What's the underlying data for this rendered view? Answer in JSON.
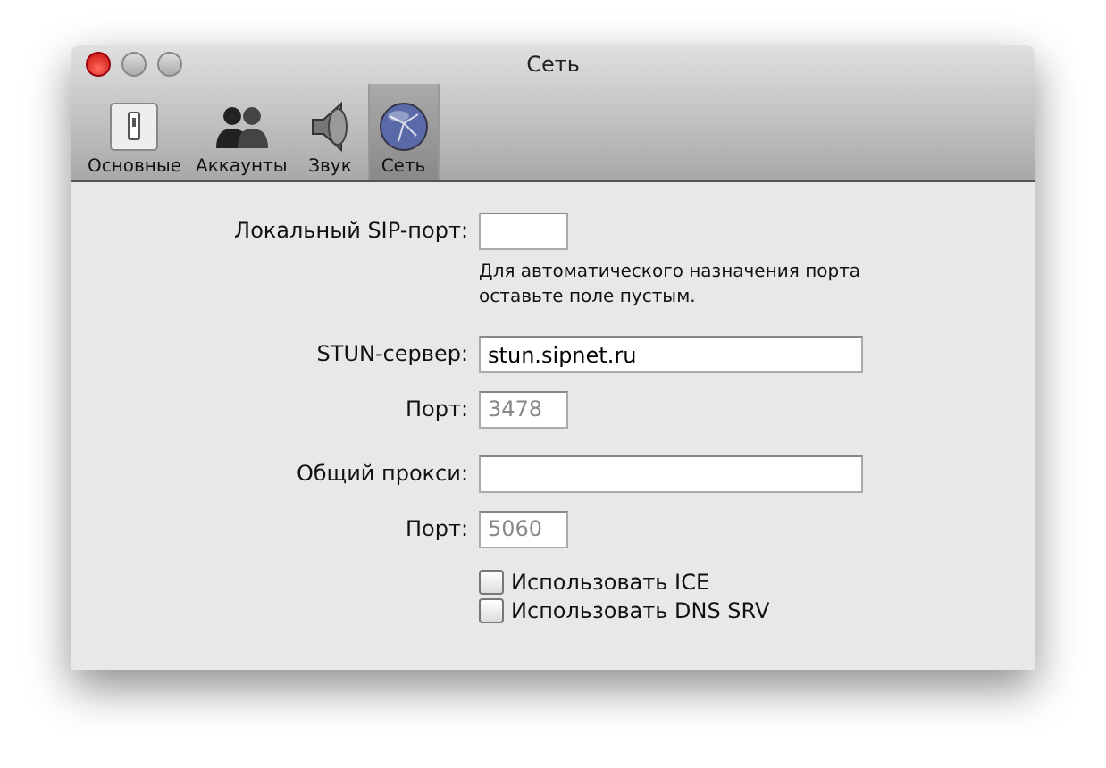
{
  "window": {
    "title": "Сеть"
  },
  "toolbar": [
    {
      "label": "Основные",
      "selected": false
    },
    {
      "label": "Аккаунты",
      "selected": false
    },
    {
      "label": "Звук",
      "selected": false
    },
    {
      "label": "Сеть",
      "selected": true
    }
  ],
  "form": [
    {
      "kind": "port",
      "label": "Локальный SIP-порт:"
    },
    {
      "kind": "note",
      "text": "Для автоматического назначения порта оставьте поле пустым."
    },
    {
      "kind": "field",
      "label": "STUN-сервер:",
      "value": "stun.sipnet.ru"
    },
    {
      "kind": "port",
      "label": "Порт:",
      "placeholder": "3478"
    },
    {
      "kind": "field",
      "label": "Общий прокси:"
    },
    {
      "kind": "port",
      "label": "Порт:",
      "placeholder": "5060"
    },
    {
      "kind": "checkbox",
      "label": "Использовать ICE",
      "checked": false
    },
    {
      "kind": "checkbox",
      "label": "Использовать DNS SRV",
      "checked": false
    }
  ]
}
